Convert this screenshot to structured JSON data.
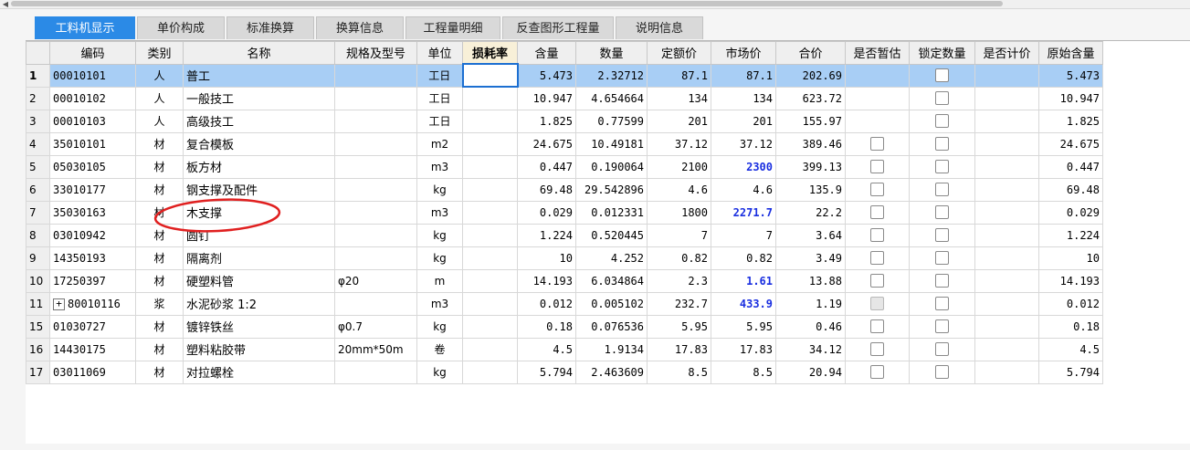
{
  "tabs": [
    {
      "label": "工料机显示",
      "active": true
    },
    {
      "label": "单价构成"
    },
    {
      "label": "标准换算"
    },
    {
      "label": "换算信息"
    },
    {
      "label": "工程量明细"
    },
    {
      "label": "反查图形工程量"
    },
    {
      "label": "说明信息"
    }
  ],
  "columns": [
    "编码",
    "类别",
    "名称",
    "规格及型号",
    "单位",
    "损耗率",
    "含量",
    "数量",
    "定额价",
    "市场价",
    "合价",
    "是否暂估",
    "锁定数量",
    "是否计价",
    "原始含量"
  ],
  "rows": [
    {
      "num": "1",
      "code": "00010101",
      "cat": "人",
      "name": "普工",
      "spec": "",
      "unit": "工日",
      "content": "5.473",
      "qty": "2.32712",
      "quota": "87.1",
      "market": "87.1",
      "total": "202.69",
      "est_cb": false,
      "lock_cb": true,
      "orig": "5.473",
      "selected": true
    },
    {
      "num": "2",
      "code": "00010102",
      "cat": "人",
      "name": "一般技工",
      "spec": "",
      "unit": "工日",
      "content": "10.947",
      "qty": "4.654664",
      "quota": "134",
      "market": "134",
      "total": "623.72",
      "est_cb": false,
      "lock_cb": true,
      "orig": "10.947"
    },
    {
      "num": "3",
      "code": "00010103",
      "cat": "人",
      "name": "高级技工",
      "spec": "",
      "unit": "工日",
      "content": "1.825",
      "qty": "0.77599",
      "quota": "201",
      "market": "201",
      "total": "155.97",
      "est_cb": false,
      "lock_cb": true,
      "orig": "1.825"
    },
    {
      "num": "4",
      "code": "35010101",
      "cat": "材",
      "name": "复合模板",
      "spec": "",
      "unit": "m2",
      "content": "24.675",
      "qty": "10.49181",
      "quota": "37.12",
      "market": "37.12",
      "total": "389.46",
      "est_cb": true,
      "lock_cb": true,
      "orig": "24.675"
    },
    {
      "num": "5",
      "code": "05030105",
      "cat": "材",
      "name": "板方材",
      "spec": "",
      "unit": "m3",
      "content": "0.447",
      "qty": "0.190064",
      "quota": "2100",
      "market": "2300",
      "market_blue": true,
      "total": "399.13",
      "est_cb": true,
      "lock_cb": true,
      "orig": "0.447"
    },
    {
      "num": "6",
      "code": "33010177",
      "cat": "材",
      "name": "钢支撑及配件",
      "spec": "",
      "unit": "kg",
      "content": "69.48",
      "qty": "29.542896",
      "quota": "4.6",
      "market": "4.6",
      "total": "135.9",
      "est_cb": true,
      "lock_cb": true,
      "orig": "69.48"
    },
    {
      "num": "7",
      "code": "35030163",
      "cat": "材",
      "name": "木支撑",
      "spec": "",
      "unit": "m3",
      "content": "0.029",
      "qty": "0.012331",
      "quota": "1800",
      "market": "2271.7",
      "market_blue": true,
      "total": "22.2",
      "est_cb": true,
      "lock_cb": true,
      "orig": "0.029"
    },
    {
      "num": "8",
      "code": "03010942",
      "cat": "材",
      "name": "圆钉",
      "spec": "",
      "unit": "kg",
      "content": "1.224",
      "qty": "0.520445",
      "quota": "7",
      "market": "7",
      "total": "3.64",
      "est_cb": true,
      "lock_cb": true,
      "orig": "1.224"
    },
    {
      "num": "9",
      "code": "14350193",
      "cat": "材",
      "name": "隔离剂",
      "spec": "",
      "unit": "kg",
      "content": "10",
      "qty": "4.252",
      "quota": "0.82",
      "market": "0.82",
      "total": "3.49",
      "est_cb": true,
      "lock_cb": true,
      "orig": "10"
    },
    {
      "num": "10",
      "code": "17250397",
      "cat": "材",
      "name": "硬塑料管",
      "spec": "φ20",
      "unit": "m",
      "content": "14.193",
      "qty": "6.034864",
      "quota": "2.3",
      "market": "1.61",
      "market_blue": true,
      "total": "13.88",
      "est_cb": true,
      "lock_cb": true,
      "orig": "14.193"
    },
    {
      "num": "11",
      "code": "80010116",
      "expander": "+",
      "cat": "浆",
      "name": "水泥砂浆 1:2",
      "spec": "",
      "unit": "m3",
      "content": "0.012",
      "qty": "0.005102",
      "quota": "232.7",
      "market": "433.9",
      "market_blue": true,
      "total": "1.19",
      "est_cb": true,
      "est_disabled": true,
      "lock_cb": true,
      "orig": "0.012"
    },
    {
      "num": "15",
      "code": "01030727",
      "cat": "材",
      "name": "镀锌铁丝",
      "spec": "φ0.7",
      "unit": "kg",
      "content": "0.18",
      "qty": "0.076536",
      "quota": "5.95",
      "market": "5.95",
      "total": "0.46",
      "est_cb": true,
      "lock_cb": true,
      "orig": "0.18"
    },
    {
      "num": "16",
      "code": "14430175",
      "cat": "材",
      "name": "塑料粘胶带",
      "spec": "20mm*50m",
      "unit": "卷",
      "content": "4.5",
      "qty": "1.9134",
      "quota": "17.83",
      "market": "17.83",
      "total": "34.12",
      "est_cb": true,
      "lock_cb": true,
      "orig": "4.5"
    },
    {
      "num": "17",
      "code": "03011069",
      "cat": "材",
      "name": "对拉螺栓",
      "spec": "",
      "unit": "kg",
      "content": "5.794",
      "qty": "2.463609",
      "quota": "8.5",
      "market": "8.5",
      "total": "20.94",
      "est_cb": true,
      "lock_cb": true,
      "orig": "5.794"
    }
  ],
  "colors": {
    "tab_active": "#2b8ae6",
    "selected_row": "#a8cef5",
    "market_highlight": "#1a2fe0",
    "annotation": "#e02020"
  }
}
